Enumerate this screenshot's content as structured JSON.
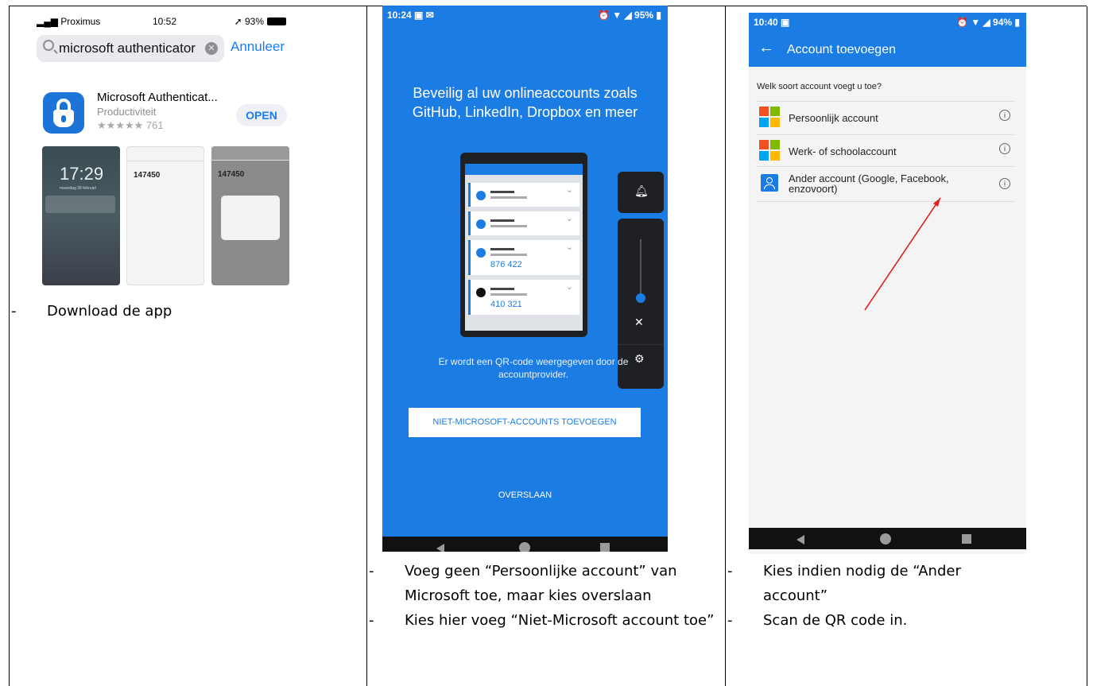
{
  "col1": {
    "status": {
      "carrier": "Proximus",
      "time": "10:52",
      "battery": "93%"
    },
    "search": {
      "query": "microsoft authenticator",
      "cancel": "Annuleer"
    },
    "app": {
      "name": "Microsoft Authenticat...",
      "category": "Productiviteit",
      "rating": "★★★★★ 761",
      "open_label": "OPEN",
      "icon": "lock-icon"
    },
    "thumbs": {
      "lock_time": "17:29",
      "lock_date": "maandag 28 februari",
      "code1": "147450",
      "code2": "147450"
    },
    "bullets": [
      "Download de app"
    ]
  },
  "col2": {
    "status": {
      "time": "10:24",
      "right": "⏰ ▼ ◢ 95% ▮"
    },
    "headline_l1": "Beveilig al uw onlineaccounts zoals",
    "headline_l2": "GitHub, LinkedIn, Dropbox en meer",
    "codes": [
      "876 422",
      "410 321"
    ],
    "subtitle_l1": "Er wordt een QR-code weergegeven door de",
    "subtitle_l2": "accountprovider.",
    "button": "NIET-MICROSOFT-ACCOUNTS TOEVOEGEN",
    "skip": "OVERSLAAN",
    "bullets": [
      "Voeg geen “Persoonlijke account” van Microsoft toe, maar kies overslaan",
      "Kies hier voeg “Niet-Microsoft account toe”"
    ]
  },
  "col3": {
    "status": {
      "time": "10:40",
      "right": "⏰ ▼ ◢ 94% ▮"
    },
    "title": "Account toevoegen",
    "question": "Welk soort account voegt u toe?",
    "options": [
      "Persoonlijk account",
      "Werk- of schoolaccount",
      "Ander account (Google, Facebook,",
      "enzovoort)"
    ],
    "ms_colors": [
      "#f25022",
      "#7fba00",
      "#00a4ef",
      "#ffb900"
    ],
    "arrow_color": "#e02020",
    "bullets": [
      "Kies indien nodig de “Ander account”",
      "Scan de QR code in."
    ]
  }
}
